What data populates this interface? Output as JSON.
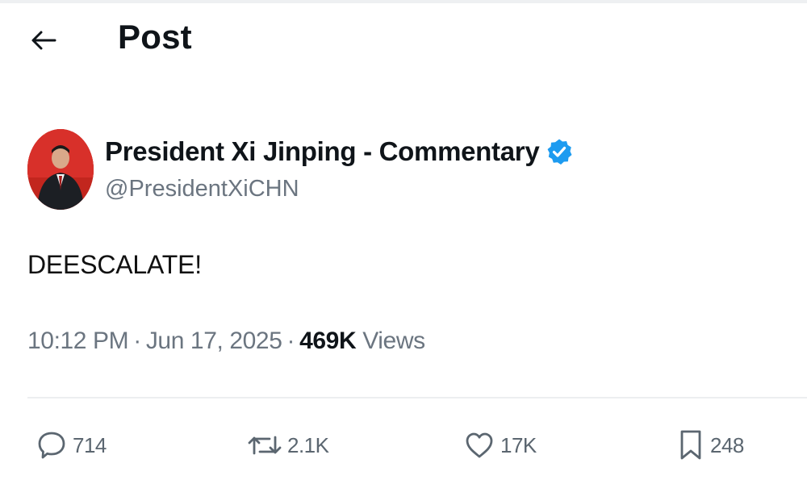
{
  "header": {
    "title": "Post"
  },
  "author": {
    "display_name": "President Xi Jinping - Commentary",
    "handle": "@PresidentXiCHN",
    "verified": true
  },
  "post": {
    "text": "DEESCALATE!",
    "time": "10:12 PM",
    "date": "Jun 17, 2025",
    "separator": "·",
    "views_count": "469K",
    "views_label": "Views"
  },
  "actions": {
    "replies": "714",
    "reposts": "2.1K",
    "likes": "17K",
    "bookmarks": "248"
  },
  "icons": {
    "back": "arrow-left-icon",
    "verified": "verified-badge-icon",
    "reply": "speech-bubble-icon",
    "repost": "repost-arrows-icon",
    "like": "heart-icon",
    "bookmark": "bookmark-icon"
  },
  "colors": {
    "verified_blue": "#1d9bf0",
    "avatar_red": "#c2261e",
    "muted_text": "#6b7580"
  }
}
